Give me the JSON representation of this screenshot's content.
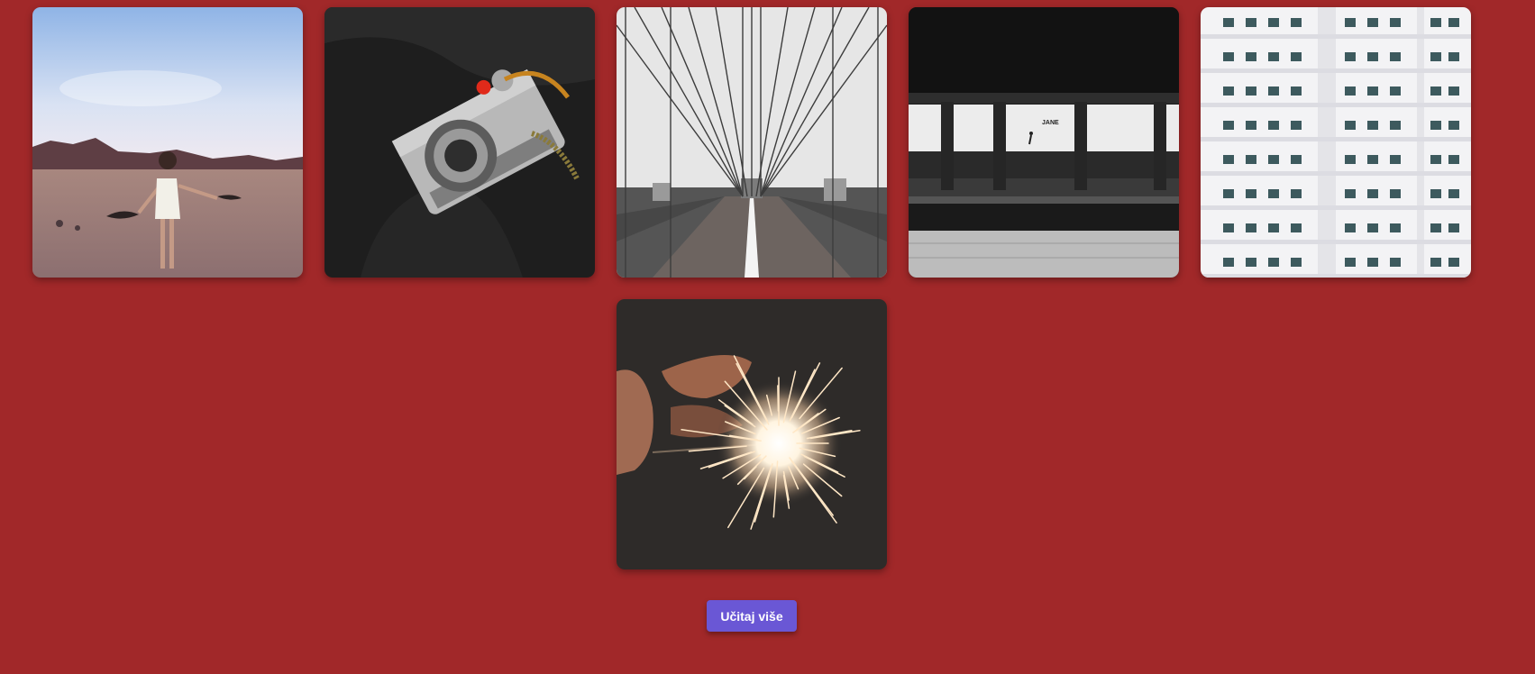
{
  "gallery": {
    "photos": [
      {
        "subject": "woman in white dress in desert"
      },
      {
        "subject": "silver film camera on dark jacket"
      },
      {
        "subject": "suspension bridge walkway"
      },
      {
        "subject": "subway platform with pillars"
      },
      {
        "subject": "white apartment building facade"
      },
      {
        "subject": "hand holding a sparkler"
      }
    ],
    "subway_sign_text": "JANE",
    "load_more_label": "Učitaj više"
  },
  "colors": {
    "background": "#a12829",
    "button": "#6a57d5",
    "button_text": "#ffffff"
  }
}
